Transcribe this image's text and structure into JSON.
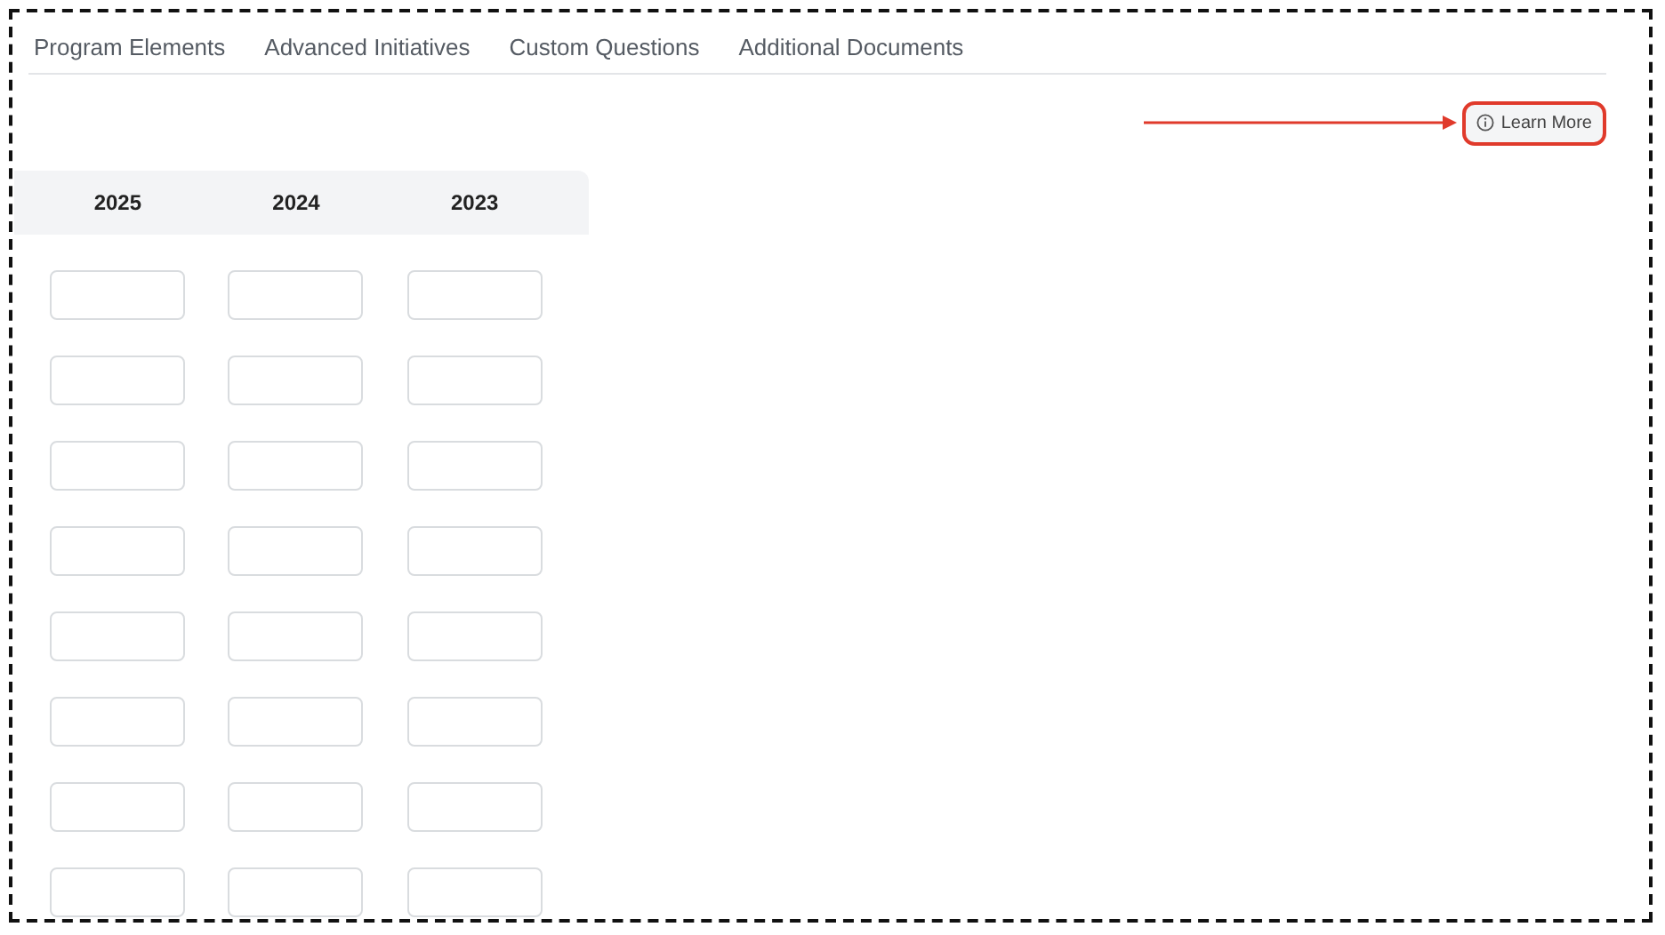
{
  "tabs": [
    {
      "label": "Program Elements",
      "selected": false
    },
    {
      "label": "Advanced Initiatives",
      "selected": false
    },
    {
      "label": "Custom Questions",
      "selected": false
    },
    {
      "label": "Additional Documents",
      "selected": false
    }
  ],
  "learn_more": {
    "label": "Learn More",
    "highlighted": true
  },
  "annotation": {
    "kind": "arrow"
  },
  "table": {
    "columns": [
      "2025",
      "2024",
      "2023"
    ],
    "rows": [
      {
        "kind": "inputs"
      },
      {
        "kind": "inputs"
      },
      {
        "kind": "inputs"
      },
      {
        "kind": "inputs"
      },
      {
        "kind": "inputs"
      },
      {
        "kind": "inputs"
      },
      {
        "kind": "inputs"
      },
      {
        "kind": "inputs"
      }
    ]
  }
}
